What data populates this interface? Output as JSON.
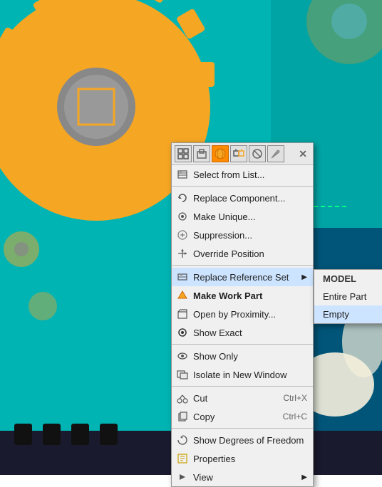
{
  "background": {
    "main_color": "#00b4b4",
    "gear_color": "#f5a623"
  },
  "toolbar": {
    "icons": [
      {
        "name": "tb-icon-1",
        "symbol": "⊞",
        "active": false
      },
      {
        "name": "tb-icon-2",
        "symbol": "◈",
        "active": false
      },
      {
        "name": "tb-icon-3",
        "symbol": "●",
        "active": true
      },
      {
        "name": "tb-icon-4",
        "symbol": "⊕",
        "active": false
      },
      {
        "name": "tb-icon-5",
        "symbol": "⊘",
        "active": false
      },
      {
        "name": "tb-icon-6",
        "symbol": "✏",
        "active": false
      }
    ],
    "close_label": "✕"
  },
  "menu": {
    "items": [
      {
        "id": "select-list",
        "icon": "📋",
        "label": "Select from List...",
        "shortcut": "",
        "has_arrow": false,
        "bold": false,
        "separator_after": false
      },
      {
        "id": "separator1",
        "type": "separator"
      },
      {
        "id": "replace-component",
        "icon": "🔄",
        "label": "Replace Component...",
        "shortcut": "",
        "has_arrow": false,
        "bold": false,
        "separator_after": false
      },
      {
        "id": "make-unique",
        "icon": "✦",
        "label": "Make Unique...",
        "shortcut": "",
        "has_arrow": false,
        "bold": false,
        "separator_after": false
      },
      {
        "id": "suppression",
        "icon": "⚙",
        "label": "Suppression...",
        "shortcut": "",
        "has_arrow": false,
        "bold": false,
        "separator_after": false
      },
      {
        "id": "override-position",
        "icon": "↕",
        "label": "Override Position",
        "shortcut": "",
        "has_arrow": false,
        "bold": false,
        "separator_after": false
      },
      {
        "id": "separator2",
        "type": "separator"
      },
      {
        "id": "replace-ref-set",
        "icon": "⊡",
        "label": "Replace Reference Set",
        "shortcut": "",
        "has_arrow": true,
        "bold": false,
        "separator_after": false,
        "active_submenu": true
      },
      {
        "id": "make-work-part",
        "icon": "◆",
        "label": "Make Work Part",
        "shortcut": "",
        "has_arrow": false,
        "bold": true,
        "separator_after": false
      },
      {
        "id": "open-proximity",
        "icon": "📂",
        "label": "Open by Proximity...",
        "shortcut": "",
        "has_arrow": false,
        "bold": false,
        "separator_after": false
      },
      {
        "id": "show-exact",
        "icon": "◈",
        "label": "Show Exact",
        "shortcut": "",
        "has_arrow": false,
        "bold": false,
        "separator_after": false
      },
      {
        "id": "separator3",
        "type": "separator"
      },
      {
        "id": "show-only",
        "icon": "👁",
        "label": "Show Only",
        "shortcut": "",
        "has_arrow": false,
        "bold": false,
        "separator_after": false
      },
      {
        "id": "isolate-new-window",
        "icon": "⧉",
        "label": "Isolate in New Window",
        "shortcut": "",
        "has_arrow": false,
        "bold": false,
        "separator_after": false
      },
      {
        "id": "separator4",
        "type": "separator"
      },
      {
        "id": "cut",
        "icon": "✂",
        "label": "Cut",
        "shortcut": "Ctrl+X",
        "has_arrow": false,
        "bold": false,
        "separator_after": false
      },
      {
        "id": "copy",
        "icon": "⧉",
        "label": "Copy",
        "shortcut": "Ctrl+C",
        "has_arrow": false,
        "bold": false,
        "separator_after": false
      },
      {
        "id": "separator5",
        "type": "separator"
      },
      {
        "id": "show-dof",
        "icon": "⟳",
        "label": "Show Degrees of Freedom",
        "shortcut": "",
        "has_arrow": false,
        "bold": false,
        "separator_after": false
      },
      {
        "id": "properties",
        "icon": "⊞",
        "label": "Properties",
        "shortcut": "",
        "has_arrow": false,
        "bold": false,
        "separator_after": false
      },
      {
        "id": "view",
        "icon": "▷",
        "label": "View",
        "shortcut": "",
        "has_arrow": true,
        "bold": false,
        "separator_after": false
      }
    ]
  },
  "submenu": {
    "items": [
      {
        "id": "model",
        "label": "MODEL",
        "bold": true
      },
      {
        "id": "entire-part",
        "label": "Entire Part",
        "bold": false
      },
      {
        "id": "empty",
        "label": "Empty",
        "bold": false
      }
    ]
  }
}
